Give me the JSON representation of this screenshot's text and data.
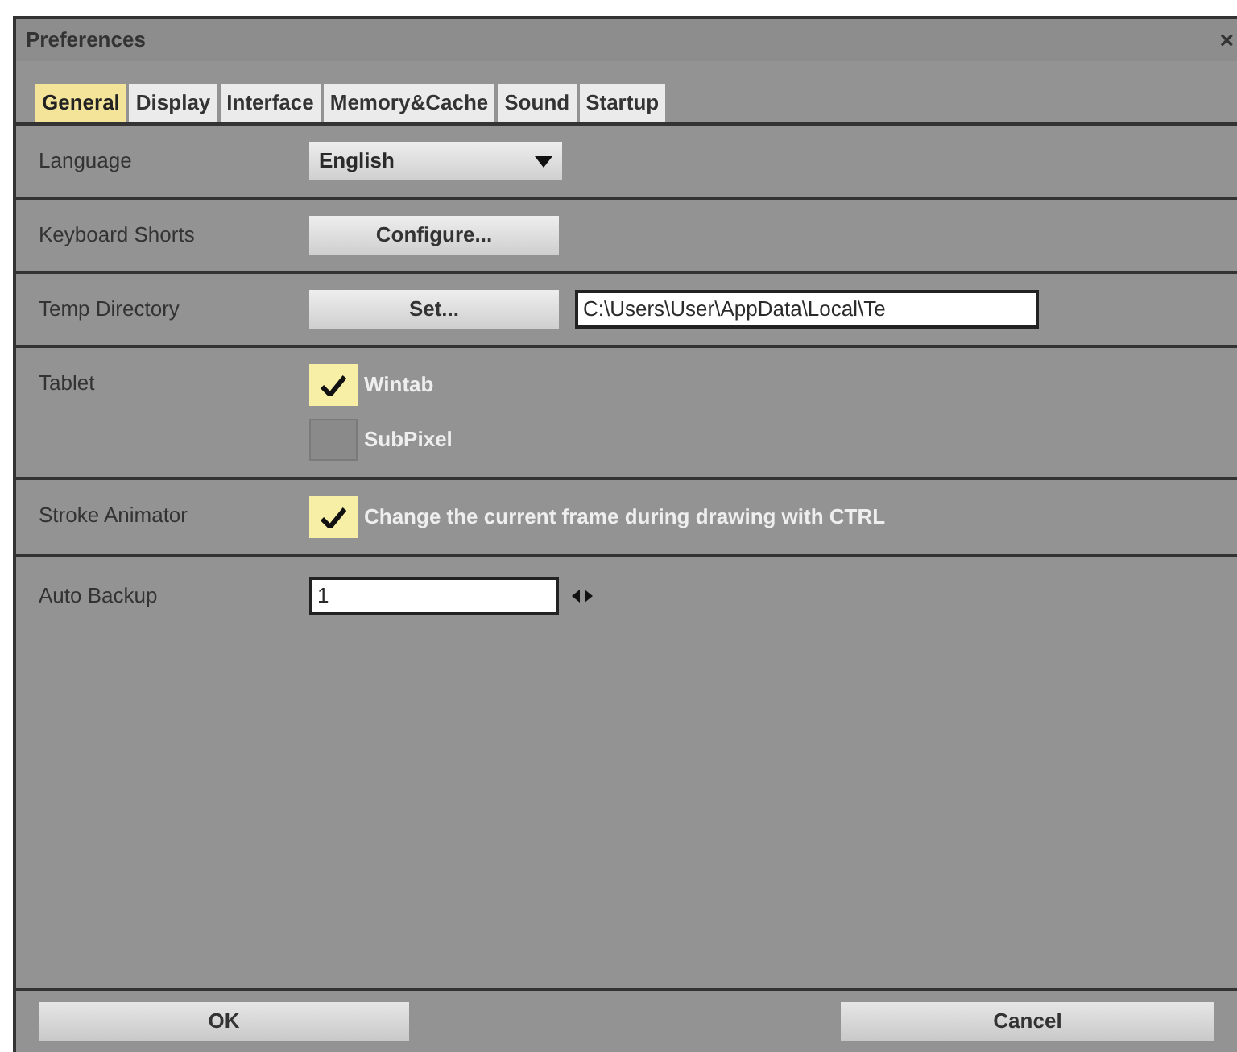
{
  "window": {
    "title": "Preferences",
    "close": "×"
  },
  "tabs": [
    {
      "label": "General",
      "selected": true
    },
    {
      "label": "Display",
      "selected": false
    },
    {
      "label": "Interface",
      "selected": false
    },
    {
      "label": "Memory&Cache",
      "selected": false
    },
    {
      "label": "Sound",
      "selected": false
    },
    {
      "label": "Startup",
      "selected": false
    }
  ],
  "rows": [
    {
      "kind": "dropdown",
      "label": "Language",
      "value": "English"
    },
    {
      "kind": "button",
      "label": "Keyboard Shorts",
      "button": "Configure..."
    },
    {
      "kind": "path",
      "label": "Temp Directory",
      "button": "Set...",
      "value": "C:\\Users\\User\\AppData\\Local\\Te"
    },
    {
      "kind": "checks",
      "label": "Tablet",
      "options": [
        {
          "label": "Wintab",
          "checked": true
        },
        {
          "label": "SubPixel",
          "checked": false
        }
      ]
    },
    {
      "kind": "checks",
      "label": "Stroke Animator",
      "options": [
        {
          "label": "Change the current frame during drawing with CTRL",
          "checked": true
        }
      ]
    },
    {
      "kind": "spinner",
      "label": "Auto Backup",
      "value": "1"
    }
  ],
  "buttons": [
    "OK",
    "Cancel"
  ]
}
